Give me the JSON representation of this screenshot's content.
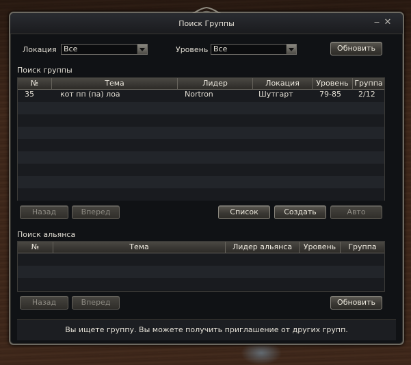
{
  "window": {
    "title": "Поиск Группы"
  },
  "filters": {
    "location_label": "Локация",
    "location_value": "Все",
    "level_label": "Уровень",
    "level_value": "Все",
    "refresh_label": "Обновить"
  },
  "party_search": {
    "section_title": "Поиск группы",
    "columns": [
      "№",
      "Тема",
      "Лидер",
      "Локация",
      "Уровень",
      "Группа"
    ],
    "rows": [
      {
        "num": "35",
        "theme": "кот пп (па) лоа",
        "leader": "Nortron",
        "location": "Шутгарт",
        "level": "79-85",
        "group": "2/12"
      }
    ],
    "back_label": "Назад",
    "forward_label": "Вперед",
    "list_label": "Список",
    "create_label": "Создать",
    "auto_label": "Авто"
  },
  "alliance_search": {
    "section_title": "Поиск альянса",
    "columns": [
      "№",
      "Тема",
      "Лидер альянса",
      "Уровень",
      "Группа"
    ],
    "back_label": "Назад",
    "forward_label": "Вперед",
    "refresh_label": "Обновить"
  },
  "status": {
    "message": "Вы ищете группу. Вы можете получить приглашение от других групп."
  },
  "icons": {
    "minimize": "minimize-icon",
    "close": "close-icon"
  }
}
